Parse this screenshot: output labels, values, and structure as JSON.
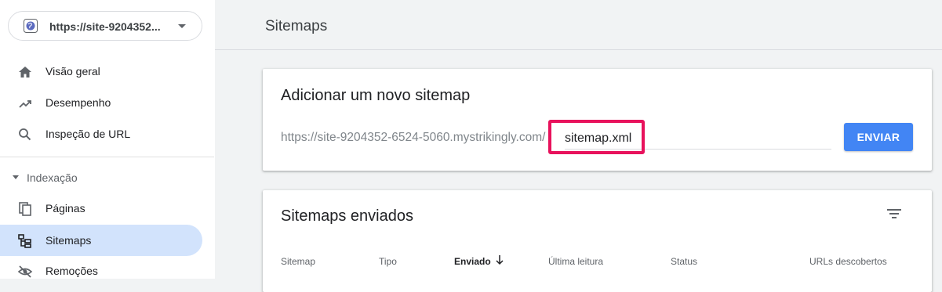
{
  "property": {
    "url": "https://site-9204352..."
  },
  "nav": {
    "items": [
      {
        "label": "Visão geral",
        "icon": "home-icon"
      },
      {
        "label": "Desempenho",
        "icon": "trending-up-icon"
      },
      {
        "label": "Inspeção de URL",
        "icon": "search-icon"
      }
    ],
    "section": "Indexação",
    "index_items": [
      {
        "label": "Páginas",
        "icon": "pages-icon"
      },
      {
        "label": "Sitemaps",
        "icon": "sitemap-icon",
        "active": true
      },
      {
        "label": "Remoções",
        "icon": "eye-off-icon"
      }
    ]
  },
  "page": {
    "title": "Sitemaps"
  },
  "add_card": {
    "title": "Adicionar um novo sitemap",
    "url_prefix": "https://site-9204352-6524-5060.mystrikingly.com/",
    "input_value": "sitemap.xml",
    "submit_label": "ENVIAR"
  },
  "sent_card": {
    "title": "Sitemaps enviados",
    "columns": [
      "Sitemap",
      "Tipo",
      "Enviado",
      "Última leitura",
      "Status",
      "URLs descobertos"
    ],
    "sorted_column": "Enviado"
  },
  "colors": {
    "accent": "#4285f4",
    "active_nav": "#d2e3fc",
    "highlight": "#e8125c"
  }
}
